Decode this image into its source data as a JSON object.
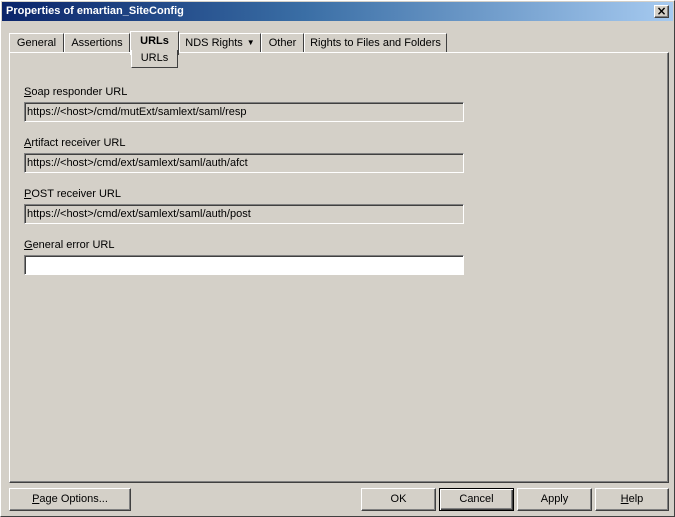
{
  "window": {
    "title": "Properties of emartian_SiteConfig",
    "close_icon": "close-icon"
  },
  "tabs": [
    {
      "label": "General"
    },
    {
      "label": "Assertions"
    },
    {
      "label": "URLs",
      "active": true
    },
    {
      "label": "NDS Rights",
      "has_dropdown": true
    },
    {
      "label": "Other"
    },
    {
      "label": "Rights to Files and Folders"
    }
  ],
  "subtab": {
    "label": "URLs"
  },
  "fields": {
    "soap": {
      "label_mn": "S",
      "label_rest": "oap responder URL",
      "value": "https://<host>/cmd/mutExt/samlext/saml/resp"
    },
    "artifact": {
      "label_mn": "A",
      "label_rest": "rtifact receiver URL",
      "value": "https://<host>/cmd/ext/samlext/saml/auth/afct"
    },
    "post": {
      "label_mn": "P",
      "label_rest": "OST receiver URL",
      "value": "https://<host>/cmd/ext/samlext/saml/auth/post"
    },
    "error": {
      "label_mn": "G",
      "label_rest": "eneral error URL",
      "value": ""
    }
  },
  "buttons": {
    "page_options_mn": "P",
    "page_options_rest": "age Options...",
    "ok": "OK",
    "cancel": "Cancel",
    "apply": "Apply",
    "help_mn": "H",
    "help_rest": "elp"
  },
  "colors": {
    "titlebar_start": "#0a246a",
    "titlebar_end": "#a6caf0",
    "face": "#d4d0c8"
  }
}
